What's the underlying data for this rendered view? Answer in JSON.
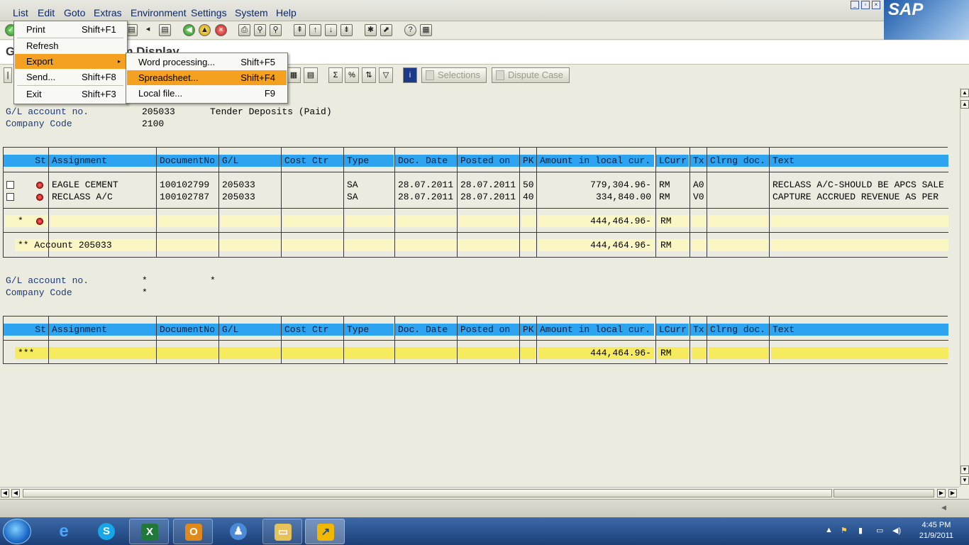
{
  "menubar": {
    "items": [
      "List",
      "Edit",
      "Goto",
      "Extras",
      "Environment",
      "Settings",
      "System",
      "Help"
    ]
  },
  "logo": "SAP",
  "title": "G/L Account Line Item Display",
  "app_toolbar": {
    "selections": "Selections",
    "dispute_case": "Dispute Case"
  },
  "list_menu": {
    "items": [
      {
        "label": "Print",
        "shortcut": "Shift+F1"
      },
      {
        "label": "Refresh",
        "shortcut": ""
      },
      {
        "label": "Export",
        "shortcut": ""
      },
      {
        "label": "Send...",
        "shortcut": "Shift+F8"
      },
      {
        "label": "Exit",
        "shortcut": "Shift+F3"
      }
    ]
  },
  "export_menu": {
    "items": [
      {
        "label": "Word processing...",
        "shortcut": "Shift+F5"
      },
      {
        "label": "Spreadsheet...",
        "shortcut": "Shift+F4"
      },
      {
        "label": "Local file...",
        "shortcut": "F9"
      }
    ]
  },
  "header1": {
    "gl_label": "G/L account no.",
    "gl_value": "205033",
    "gl_desc": "Tender Deposits (Paid)",
    "cc_label": "Company Code",
    "cc_value": "2100"
  },
  "header2": {
    "gl_label": "G/L account no.",
    "gl_value": "*",
    "gl_desc": "*",
    "cc_label": "Company Code",
    "cc_value": "*"
  },
  "columns": [
    "St",
    "Assignment",
    "DocumentNo",
    "G/L",
    "Cost Ctr",
    "Type",
    "Doc. Date",
    "Posted on",
    "PK",
    "Amount in local cur.",
    "LCurr",
    "Tx",
    "Clrng doc.",
    "Text"
  ],
  "rows": [
    {
      "assignment": "EAGLE CEMENT",
      "docno": "100102799",
      "gl": "205033",
      "costctr": "",
      "type": "SA",
      "docdate": "28.07.2011",
      "posted": "28.07.2011",
      "pk": "50",
      "amount": "779,304.96-",
      "lcurr": "RM",
      "tx": "A0",
      "clrng": "",
      "text": "RECLASS A/C-SHOULD BE APCS SALE"
    },
    {
      "assignment": "RECLASS A/C",
      "docno": "100102787",
      "gl": "205033",
      "costctr": "",
      "type": "SA",
      "docdate": "28.07.2011",
      "posted": "28.07.2011",
      "pk": "40",
      "amount": "334,840.00",
      "lcurr": "RM",
      "tx": "V0",
      "clrng": "",
      "text": "CAPTURE ACCRUED REVENUE AS PER"
    }
  ],
  "subtotal": {
    "marker": "*",
    "amount": "444,464.96-",
    "lcurr": "RM"
  },
  "account_total": {
    "label": "** Account 205033",
    "amount": "444,464.96-",
    "lcurr": "RM"
  },
  "grand_total": {
    "label": "***",
    "amount": "444,464.96-",
    "lcurr": "RM"
  },
  "clock": {
    "time": "4:45 PM",
    "date": "21/9/2011"
  },
  "colors": {
    "header_blue": "#2ea4f0",
    "sum_yellow": "#fbf7c4",
    "total_yellow": "#f6ea5e",
    "menu_highlight": "#f4a020"
  }
}
